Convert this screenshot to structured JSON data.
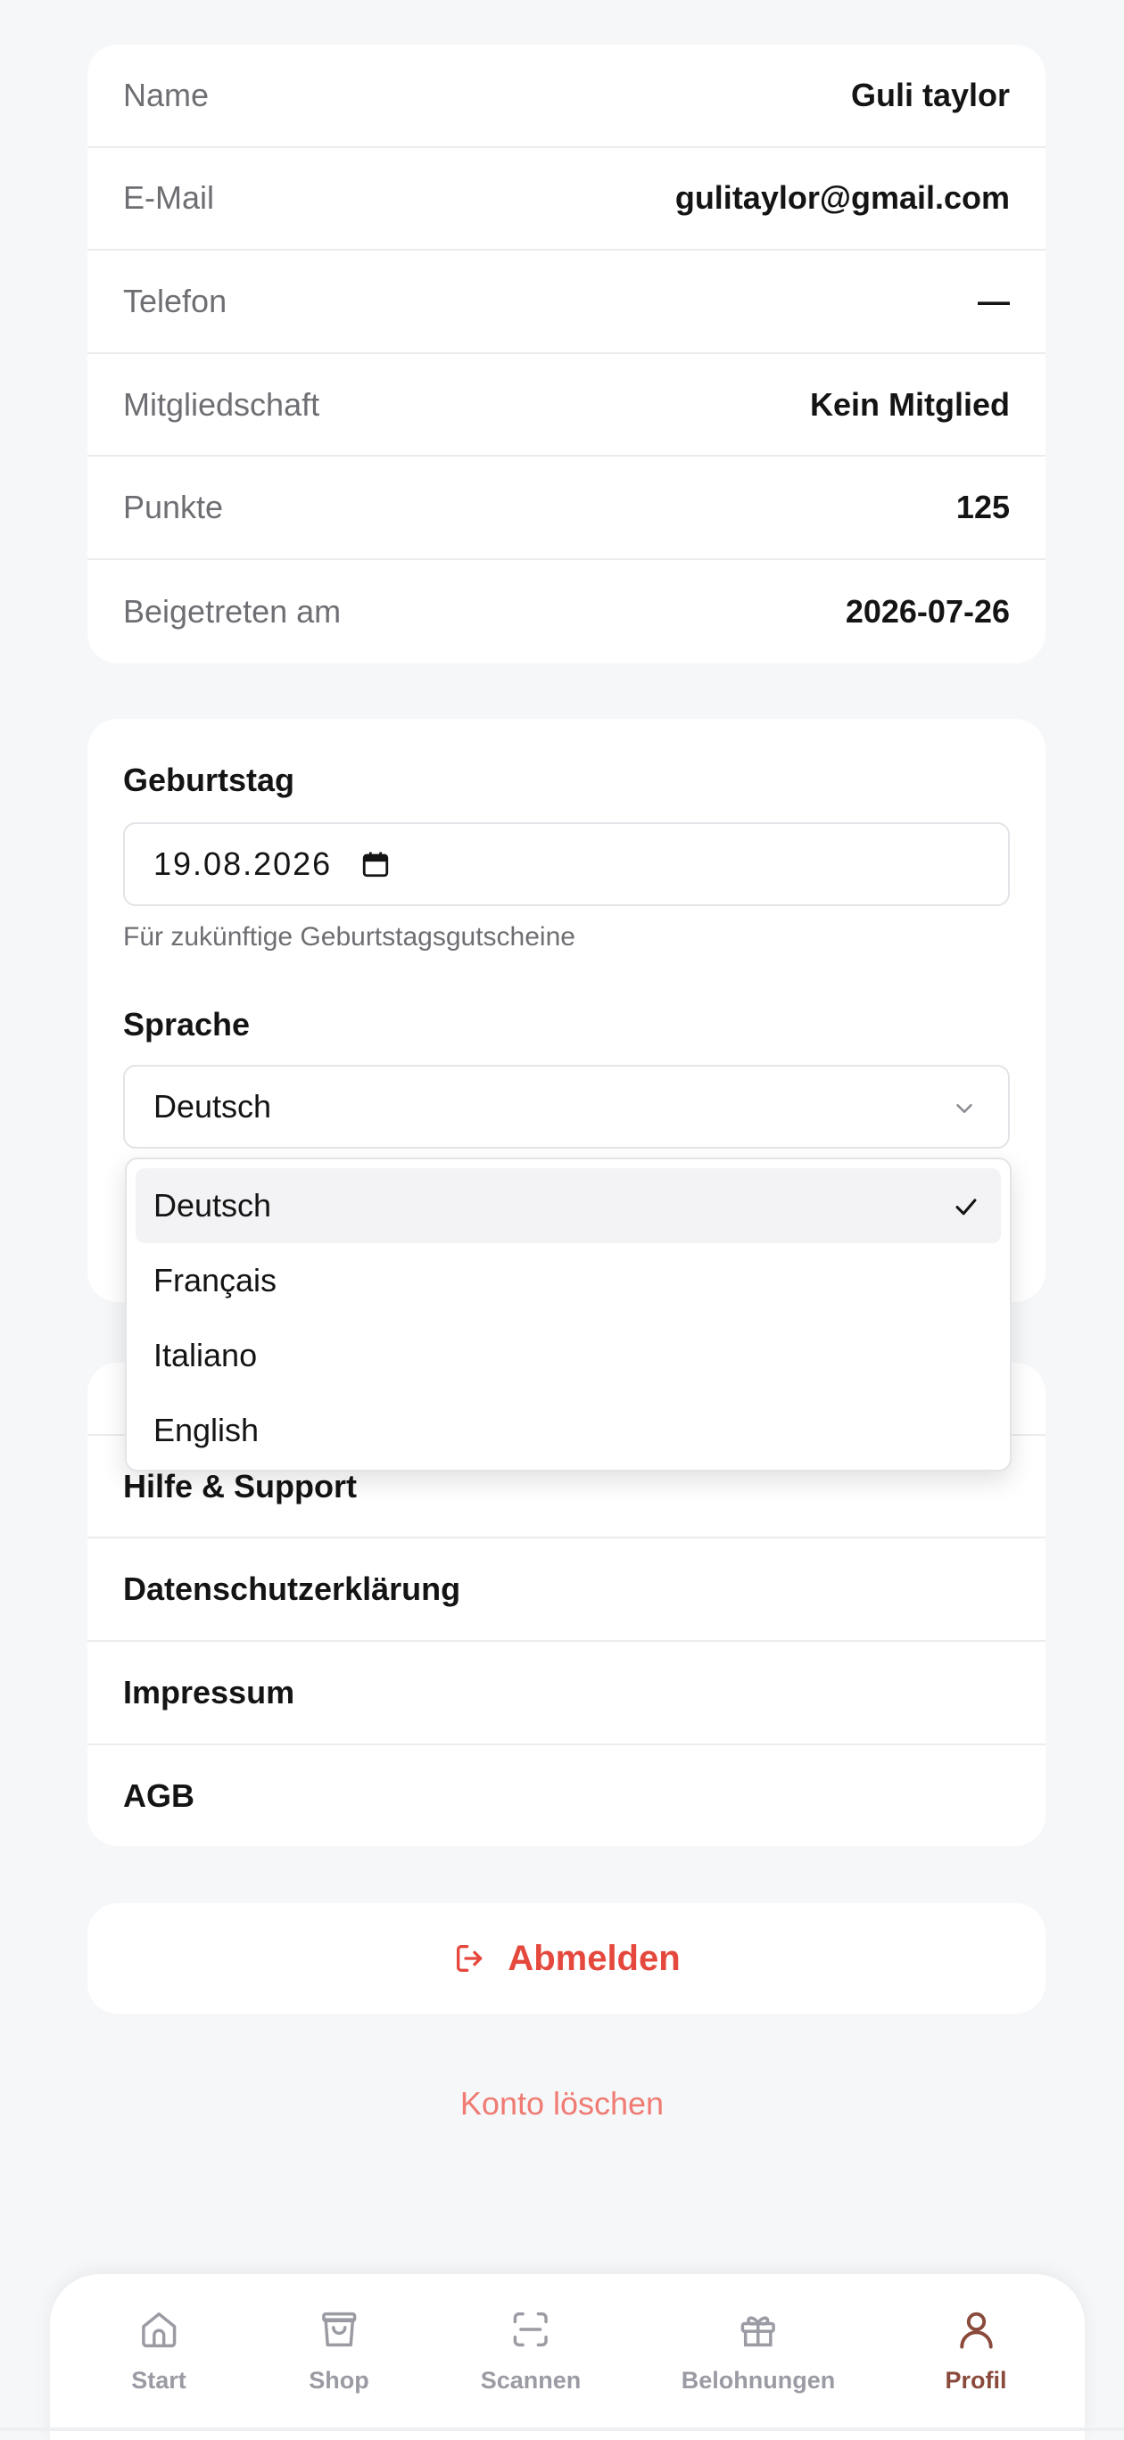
{
  "profile": {
    "rows": [
      {
        "label": "Name",
        "value": "Guli taylor"
      },
      {
        "label": "E-Mail",
        "value": "gulitaylor@gmail.com"
      },
      {
        "label": "Telefon",
        "value": "—"
      },
      {
        "label": "Mitgliedschaft",
        "value": "Kein Mitglied"
      },
      {
        "label": "Punkte",
        "value": "125"
      },
      {
        "label": "Beigetreten am",
        "value": "2026-07-26"
      }
    ]
  },
  "settings": {
    "birthday_label": "Geburtstag",
    "birthday_value": "19.08.2026",
    "birthday_hint": "Für zukünftige Geburtstagsgutscheine",
    "language_label": "Sprache",
    "language_value": "Deutsch"
  },
  "language_dropdown": {
    "options": [
      "Deutsch",
      "Français",
      "Italiano",
      "English"
    ],
    "selected": "Deutsch"
  },
  "links": {
    "items": [
      "Hilfe & Support",
      "Datenschutzerklärung",
      "Impressum",
      "AGB"
    ]
  },
  "logout": {
    "label": "Abmelden"
  },
  "delete_account": {
    "label": "Konto löschen"
  },
  "nav": {
    "items": [
      {
        "label": "Start",
        "icon": "home-icon"
      },
      {
        "label": "Shop",
        "icon": "shopping-bag-icon"
      },
      {
        "label": "Scannen",
        "icon": "scan-icon"
      },
      {
        "label": "Belohnungen",
        "icon": "gift-icon"
      },
      {
        "label": "Profil",
        "icon": "user-icon"
      }
    ],
    "active": "Profil"
  },
  "colors": {
    "danger": "#e5483d",
    "danger_light": "#ef7b73",
    "active_nav": "#8a4a3c",
    "inactive_nav": "#9a9ba3"
  }
}
